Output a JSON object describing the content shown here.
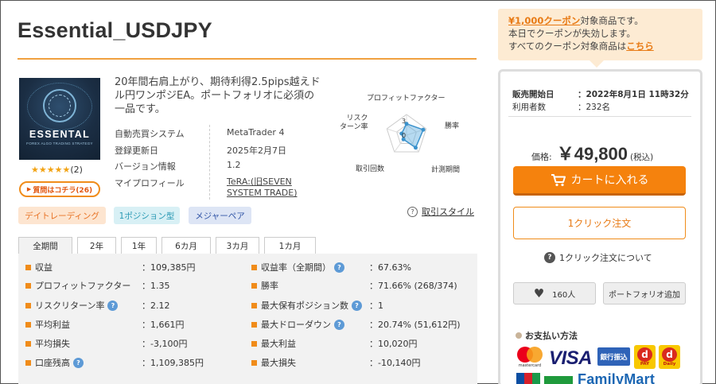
{
  "product": {
    "title": "Essential_USDJPY",
    "image_brand": "ESSENTAL",
    "image_sub": "FOREX ALGO TRADING STRATEGY",
    "rating_stars": "★★★★★",
    "rating_count": "(2)",
    "question_button": "質問はコチラ(26)",
    "description": "20年間右肩上がり、期待利得2.5pips越えドル円ワンポジEA。ポートフォリオに必須の一品です。"
  },
  "spec": [
    {
      "key": "自動売買システム",
      "value": "MetaTrader 4"
    },
    {
      "key": "登録更新日",
      "value": "2025年2月7日"
    },
    {
      "key": "バージョン情報",
      "value": "1.2"
    },
    {
      "key": "マイプロフィール",
      "value": "TeRA:(旧SEVEN SYSTEM TRADE)"
    }
  ],
  "radar": {
    "labels": {
      "pf": "プロフィットファクター",
      "risk": "リスク\nターン率",
      "winrate": "勝率",
      "trades": "取引回数",
      "period": "計測期間"
    },
    "scale_labels": [
      "3",
      "0"
    ],
    "levels": {
      "pf": 0.55,
      "winrate": 0.85,
      "period": 0.75,
      "trades": 0.25,
      "risk": 0.25
    }
  },
  "trade_style_help": "取引スタイル",
  "tags": [
    "デイトレーディング",
    "1ポジション型",
    "メジャーペア"
  ],
  "tabs": [
    "全期間",
    "2年",
    "1年",
    "6カ月",
    "3カ月",
    "1カ月"
  ],
  "stats_left": [
    {
      "label": "収益",
      "value": "：109,385円",
      "help": false
    },
    {
      "label": "プロフィットファクター",
      "value": "：1.35",
      "help": false
    },
    {
      "label": "リスクリターン率",
      "value": "：2.12",
      "help": true
    },
    {
      "label": "平均利益",
      "value": "：1,661円",
      "help": false
    },
    {
      "label": "平均損失",
      "value": "：-3,100円",
      "help": false
    },
    {
      "label": "口座残高",
      "value": "：1,109,385円",
      "help": true
    }
  ],
  "stats_right": [
    {
      "label": "収益率（全期間）",
      "value": "：67.63%",
      "help": true
    },
    {
      "label": "勝率",
      "value": "：71.66% (268/374)",
      "help": false
    },
    {
      "label": "最大保有ポジション数",
      "value": "：1",
      "help": true
    },
    {
      "label": "最大ドローダウン",
      "value": "：20.74% (51,612円)",
      "help": true
    },
    {
      "label": "最大利益",
      "value": "：10,020円",
      "help": false
    },
    {
      "label": "最大損失",
      "value": "：-10,140円",
      "help": false
    }
  ],
  "coupon": {
    "amount": "¥1,000クーポン",
    "line1_rest": "対象商品です。",
    "line2": "本日でクーポンが失効します。",
    "line3_pre": "すべてのクーポン対象商品は",
    "line3_link": "こちら"
  },
  "sidebar": {
    "meta": [
      {
        "key": "販売開始日",
        "value": "：2022年8月1日 11時32分"
      },
      {
        "key": "利用者数",
        "value": "：232名"
      }
    ],
    "price_label": "価格:",
    "price": "￥49,800",
    "tax": "(税込)",
    "cart_button": "カートに入れる",
    "oneclick_button": "1クリック注文",
    "oneclick_help": "1クリック注文について",
    "fav_count": "160人",
    "portfolio_button": "ポートフォリオ追加",
    "payment_title": "お支払い方法",
    "payment": {
      "mastercard": "mastercard",
      "visa": "VISA",
      "bank": "銀行振込",
      "dbadge1": "PAY",
      "dbadge2": "Daily",
      "familymart": "FamilyMart"
    }
  },
  "colors": {
    "accent": "#f5820d",
    "title_rule": "#f0a040",
    "stat_marker": "#f08c1a",
    "help_icon": "#5d9ad6"
  }
}
